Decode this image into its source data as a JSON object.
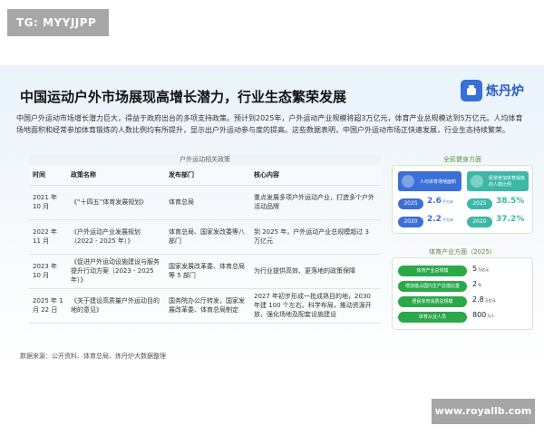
{
  "watermark_top": "TG: MYYJJPP",
  "watermark_bottom": "www.royallb.com",
  "header": {
    "title": "中国运动户外市场展现高增长潜力，行业生态繁荣发展",
    "brand_name": "炼丹炉"
  },
  "intro": "中国户外运动市场增长潜力巨大，得益于政府出台的多项支持政策。预计到2025年，户外运动产业规模将超3万亿元，体育产业总规模达到5万亿元。人均体育场地面积和经常参加体育锻炼的人数比例均有所提升，显示出户外运动参与度的提高。这些数据表明，中国户外运动市场正快速发展，行业生态持续繁荣。",
  "policy_table": {
    "title": "户外运动相关政策",
    "headers": [
      "时间",
      "政策名称",
      "发布部门",
      "核心内容"
    ],
    "rows": [
      {
        "time": "2021 年 10 月",
        "name": "《“十四五”体育发展规划》",
        "dept": "体育总局",
        "content": "重点发展多项户外运动产业，打造多个户外活动品牌"
      },
      {
        "time": "2022 年 11 月",
        "name": "《户外运动产业发展规划（2022 - 2025 年）》",
        "dept": "体育总局、国家发改委等八部门",
        "content": "到 2025 年，户外运动产业总规模超过 3 万亿元"
      },
      {
        "time": "2023 年 10 月",
        "name": "《促进户外运动设施建设与服务提升行动方案（2023 - 2025 年）》",
        "dept": "国家发展改革委、体育总局等 5 部门",
        "content": "为行业提供高效、更落地的政策保障"
      },
      {
        "time": "2025 年 1 月 22 日",
        "name": "《关于建设高质量户外运动目的地的意见》",
        "dept": "国务院办公厅转发，国家发展改革委、体育总局制定",
        "content": "2027 年初步形成一批成熟目的地，2030 年建 100 个左右。科学布局，推动资源开放，强化场地及配套设施建设"
      }
    ]
  },
  "fitness": {
    "title": "全民健身方面",
    "tile_area": "人均体育场地面积",
    "tile_people": "经常参加体育锻炼的人数比例",
    "area": [
      {
        "year": "2025",
        "value": "2.6",
        "unit": "平方米"
      },
      {
        "year": "2020",
        "value": "2.2",
        "unit": "平方米"
      }
    ],
    "people": [
      {
        "year": "2025",
        "value": "38.5%"
      },
      {
        "year": "2020",
        "value": "37.2%"
      }
    ]
  },
  "sports_industry": {
    "title": "体育产业方面（2025）",
    "items": [
      {
        "label": "体育产业总规模",
        "value": "5",
        "unit": "万亿元"
      },
      {
        "label": "增加值占国内生产总值比重",
        "value": "2",
        "unit": "%"
      },
      {
        "label": "居民体育消费总规模",
        "value": "2.8",
        "unit": "万亿元"
      },
      {
        "label": "体育从业人员",
        "value": "800",
        "unit": "万人"
      }
    ]
  },
  "source": "数据来源：公开资料、体育总局、炼丹炉大数据整理",
  "colors": {
    "blue": "#3b6fd8",
    "teal": "#3cb8a6",
    "green": "#2ba84a"
  }
}
